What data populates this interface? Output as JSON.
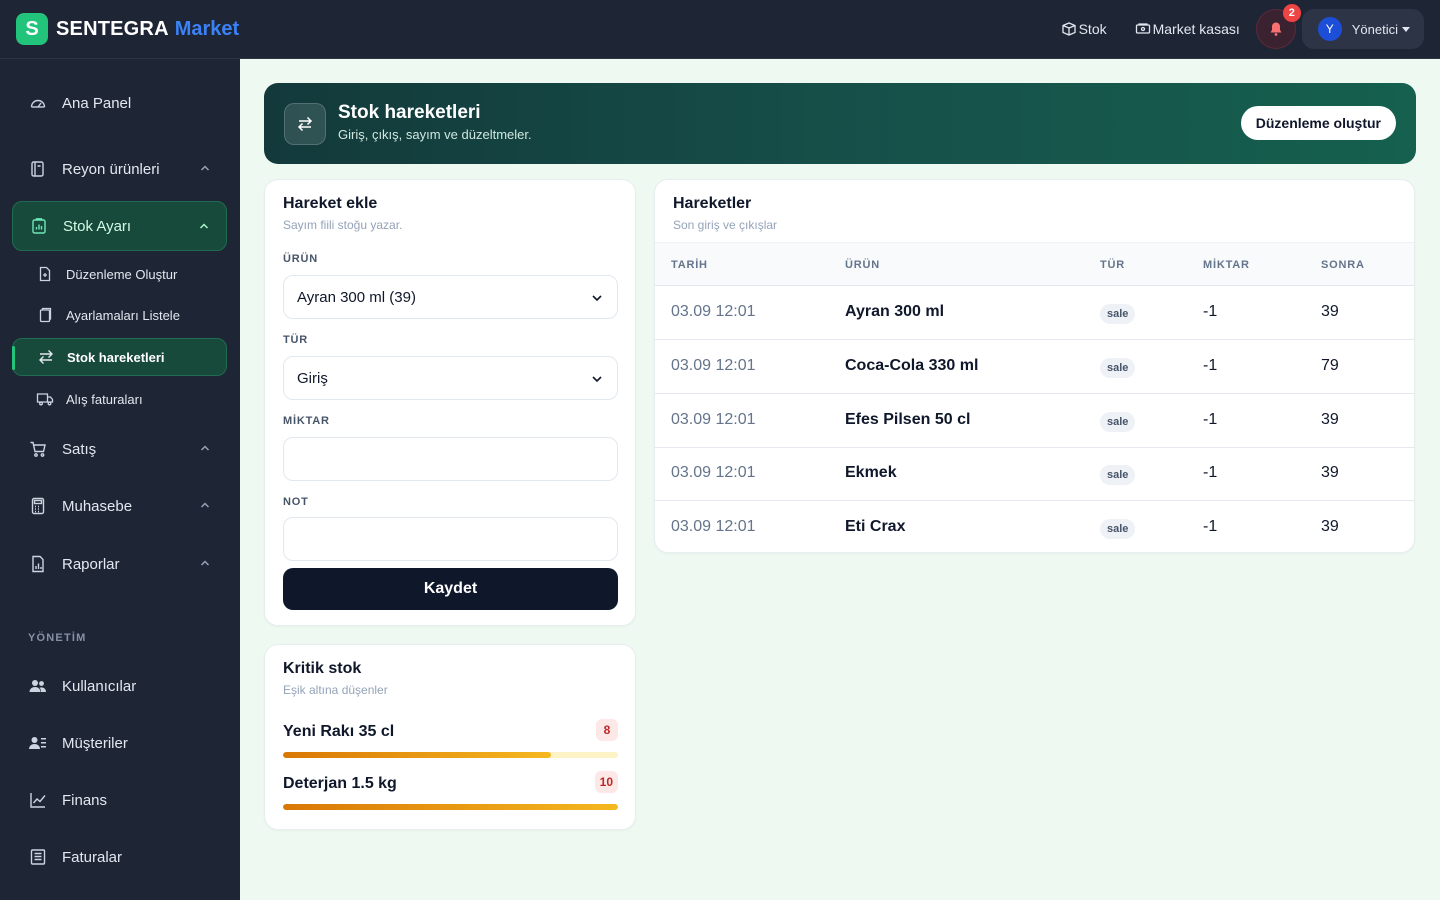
{
  "brand": {
    "name": "SENTEGRA",
    "accent": "Market",
    "logo_glyph": "S"
  },
  "topbar": {
    "links": [
      {
        "label": "Stok",
        "icon": "box-icon"
      },
      {
        "label": "Market kasası",
        "icon": "cash-register-icon"
      }
    ],
    "notifications": {
      "count": "2"
    },
    "user": {
      "initial": "Y",
      "name": "Yönetici"
    }
  },
  "sidebar": {
    "items": [
      {
        "label": "Ana Panel"
      },
      {
        "label": "Reyon ürünleri"
      },
      {
        "label": "Stok Ayarı"
      },
      {
        "label": "Satış"
      },
      {
        "label": "Muhasebe"
      },
      {
        "label": "Raporlar"
      }
    ],
    "subitems": [
      {
        "label": "Düzenleme Oluştur"
      },
      {
        "label": "Ayarlamaları Listele"
      },
      {
        "label": "Stok hareketleri"
      },
      {
        "label": "Alış faturaları"
      }
    ],
    "section_label": "YÖNETİM",
    "admin_items": [
      {
        "label": "Kullanıcılar"
      },
      {
        "label": "Müşteriler"
      },
      {
        "label": "Finans"
      },
      {
        "label": "Faturalar"
      }
    ]
  },
  "hero": {
    "title": "Stok hareketleri",
    "subtitle": "Giriş, çıkış, sayım ve düzeltmeler.",
    "button_label": "Düzenleme oluştur"
  },
  "form": {
    "title": "Hareket ekle",
    "subtitle": "Sayım fiili stoğu yazar.",
    "product_label": "ÜRÜN",
    "product_value": "Ayran 300 ml (39)",
    "type_label": "TÜR",
    "type_value": "Giriş",
    "qty_label": "MİKTAR",
    "qty_value": "",
    "note_label": "NOT",
    "note_value": "",
    "save_label": "Kaydet"
  },
  "critical": {
    "title": "Kritik stok",
    "subtitle": "Eşik altına düşenler",
    "items": [
      {
        "name": "Yeni Rakı 35 cl",
        "count": "8",
        "level_pct": 80
      },
      {
        "name": "Deterjan 1.5 kg",
        "count": "10",
        "level_pct": 100
      }
    ]
  },
  "movements": {
    "title": "Hareketler",
    "subtitle": "Son giriş ve çıkışlar",
    "headers": {
      "date": "TARİH",
      "product": "ÜRÜN",
      "type": "TÜR",
      "qty": "MİKTAR",
      "after": "SONRA"
    },
    "rows": [
      {
        "date": "03.09 12:01",
        "product": "Ayran 300 ml",
        "type": "sale",
        "qty": "-1",
        "after": "39"
      },
      {
        "date": "03.09 12:01",
        "product": "Coca-Cola 330 ml",
        "type": "sale",
        "qty": "-1",
        "after": "79"
      },
      {
        "date": "03.09 12:01",
        "product": "Efes Pilsen 50 cl",
        "type": "sale",
        "qty": "-1",
        "after": "39"
      },
      {
        "date": "03.09 12:01",
        "product": "Ekmek",
        "type": "sale",
        "qty": "-1",
        "after": "39"
      },
      {
        "date": "03.09 12:01",
        "product": "Eti Crax",
        "type": "sale",
        "qty": "-1",
        "after": "39"
      }
    ]
  },
  "colors": {
    "accent": "#22c37a",
    "brand_blue": "#3b82f6",
    "sidebar_bg": "#1e2535",
    "danger": "#ef4444"
  }
}
